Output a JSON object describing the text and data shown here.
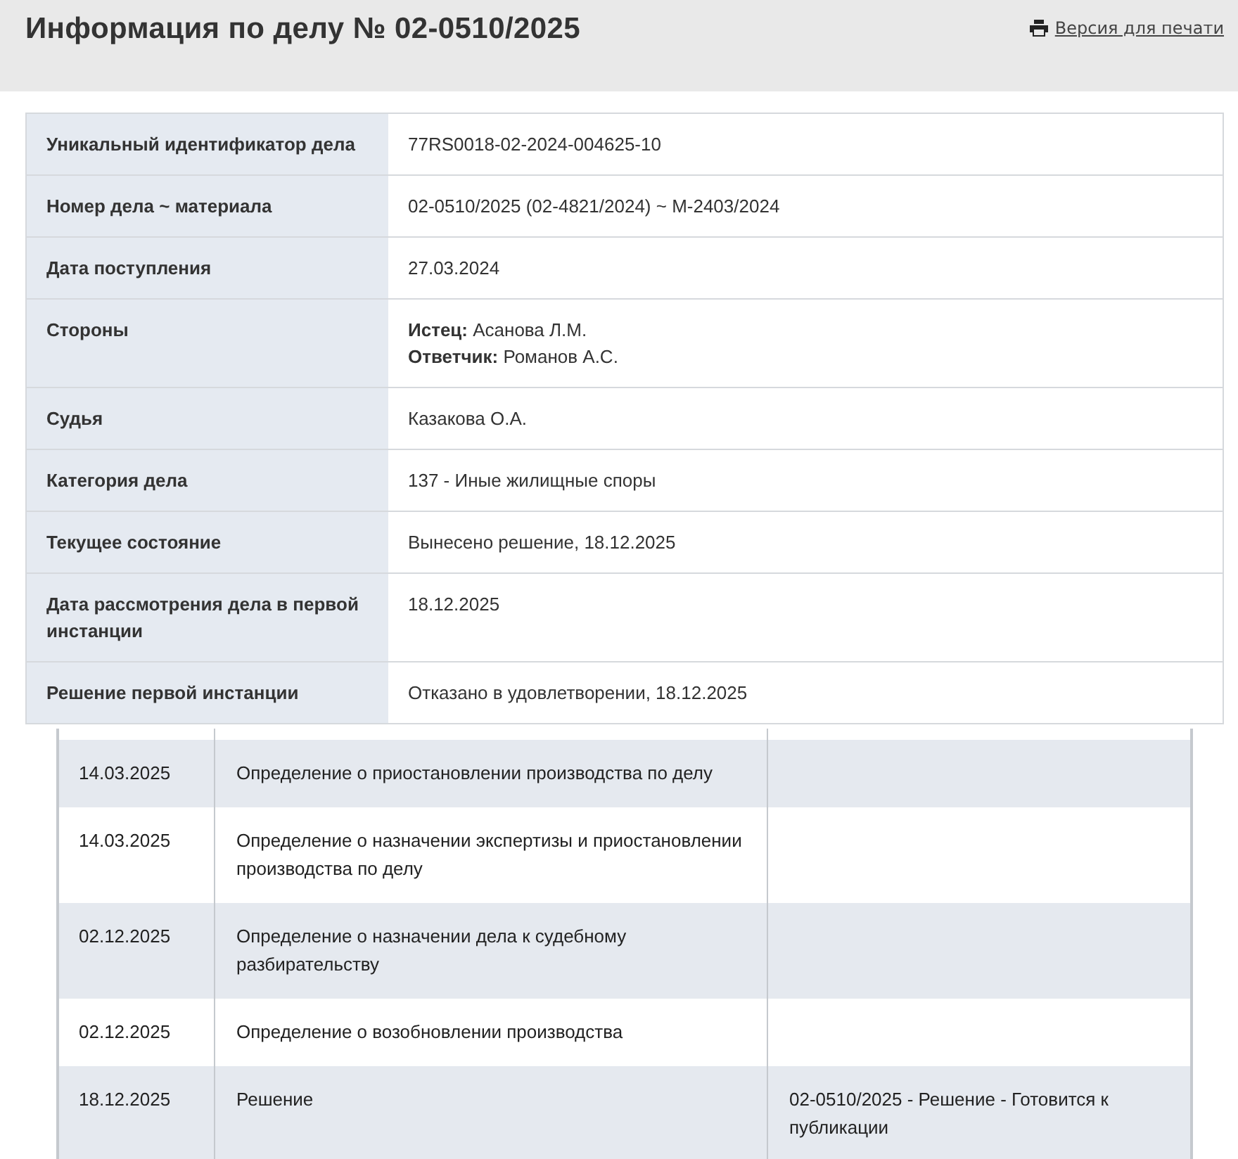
{
  "header": {
    "title": "Информация по делу № 02-0510/2025",
    "print_link": "Версия для печати"
  },
  "case_info": [
    {
      "label": "Уникальный идентификатор дела",
      "values": [
        "77RS0018-02-2024-004625-10"
      ]
    },
    {
      "label": "Номер дела ~ материала",
      "values": [
        "02-0510/2025 (02-4821/2024) ~ М-2403/2024"
      ]
    },
    {
      "label": "Дата поступления",
      "values": [
        "27.03.2024"
      ]
    },
    {
      "label": "Стороны",
      "values": [
        "**Истец:** Асанова Л.М.",
        "**Ответчик:** Романов А.С."
      ]
    },
    {
      "label": "Судья",
      "values": [
        "Казакова О.А."
      ]
    },
    {
      "label": "Категория дела",
      "values": [
        "137 - Иные жилищные споры"
      ]
    },
    {
      "label": "Текущее состояние",
      "values": [
        "Вынесено решение, 18.12.2025"
      ]
    },
    {
      "label": "Дата рассмотрения дела в первой инстанции",
      "values": [
        "18.12.2025"
      ]
    },
    {
      "label": "Решение первой инстанции",
      "values": [
        "Отказано в удовлетворении, 18.12.2025"
      ]
    }
  ],
  "documents": [
    {
      "date": "14.03.2025",
      "name": "Определение о приостановлении производства по делу"
    },
    {
      "date": "14.03.2025",
      "name": "Определение о назначении экспертизы и приостановлении производства по делу"
    },
    {
      "date": "02.12.2025",
      "name": "Определение о назначении дела к судебному разбирательству"
    },
    {
      "date": "02.12.2025",
      "name": "Определение о возобновлении производства"
    },
    {
      "date": "18.12.2025",
      "name": "Решение",
      "publication": "02-0510/2025 - Решение - Готовится к публикации"
    }
  ]
}
